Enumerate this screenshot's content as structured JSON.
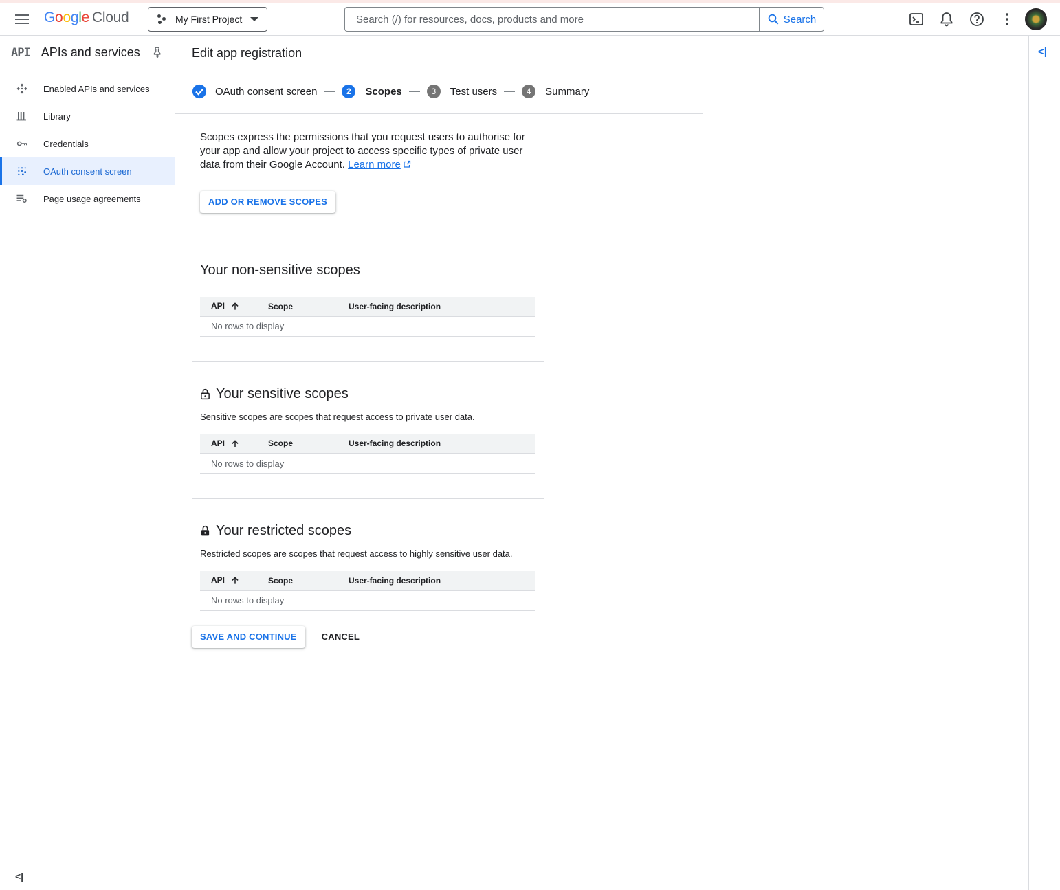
{
  "topbar": {
    "logo": {
      "g1": "G",
      "g2": "o",
      "g3": "o",
      "g4": "g",
      "g5": "l",
      "g6": "e",
      "product": "Cloud"
    },
    "project": "My First Project",
    "search_placeholder": "Search (/) for resources, docs, products and more",
    "search_button": "Search",
    "icons": [
      "menu-icon",
      "terminal-icon",
      "bell-icon",
      "help-icon",
      "more-vert-icon"
    ]
  },
  "sidebar": {
    "api_logo": "API",
    "title": "APIs and services",
    "items": [
      {
        "label": "Enabled APIs and services",
        "icon": "hub-icon"
      },
      {
        "label": "Library",
        "icon": "library-icon"
      },
      {
        "label": "Credentials",
        "icon": "key-icon"
      },
      {
        "label": "OAuth consent screen",
        "icon": "consent-grid-icon",
        "active": true
      },
      {
        "label": "Page usage agreements",
        "icon": "settings-list-icon"
      }
    ],
    "collapse": "<|"
  },
  "main": {
    "title": "Edit app registration",
    "rail_toggle": "<|",
    "steps": [
      {
        "num": "",
        "label": "OAuth consent screen",
        "state": "done"
      },
      {
        "num": "2",
        "label": "Scopes",
        "state": "current"
      },
      {
        "num": "3",
        "label": "Test users",
        "state": "pending"
      },
      {
        "num": "4",
        "label": "Summary",
        "state": "pending"
      }
    ],
    "intro": "Scopes express the permissions that you request users to authorise for your app and allow your project to access specific types of private user data from their Google Account.",
    "learn_more": "Learn more",
    "add_button": "ADD OR REMOVE SCOPES",
    "columns": {
      "api": "API",
      "scope": "Scope",
      "description": "User-facing description"
    },
    "empty": "No rows to display",
    "sections": {
      "nonsensitive": {
        "title": "Your non-sensitive scopes"
      },
      "sensitive": {
        "title": "Your sensitive scopes",
        "desc": "Sensitive scopes are scopes that request access to private user data."
      },
      "restricted": {
        "title": "Your restricted scopes",
        "desc": "Restricted scopes are scopes that request access to highly sensitive user data."
      }
    },
    "save_button": "SAVE AND CONTINUE",
    "cancel_button": "CANCEL"
  },
  "colors": {
    "accent": "#1a73e8",
    "active_bg": "#e8f0fe",
    "divider": "#dadce0"
  }
}
